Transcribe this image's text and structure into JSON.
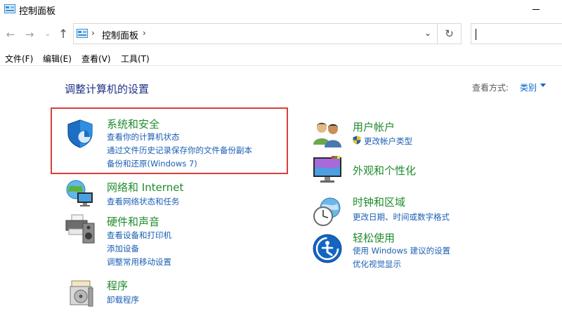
{
  "window": {
    "title": "控制面板"
  },
  "address": {
    "crumb": "控制面板",
    "separator": "›"
  },
  "search": {
    "placeholder": ""
  },
  "menu": {
    "file": "文件(F)",
    "edit": "编辑(E)",
    "view": "查看(V)",
    "tools": "工具(T)"
  },
  "main": {
    "heading": "调整计算机的设置",
    "view_by_label": "查看方式:",
    "view_by_value": "类别"
  },
  "categories": [
    {
      "title": "系统和安全",
      "icon": "shield-icon",
      "links": [
        "查看你的计算机状态",
        "通过文件历史记录保存你的文件备份副本",
        "备份和还原(Windows 7)"
      ]
    },
    {
      "title": "网络和 Internet",
      "icon": "network-globe-icon",
      "links": [
        "查看网络状态和任务"
      ]
    },
    {
      "title": "硬件和声音",
      "icon": "printer-icon",
      "links": [
        "查看设备和打印机",
        "添加设备",
        "调整常用移动设置"
      ]
    },
    {
      "title": "程序",
      "icon": "programs-icon",
      "links": [
        "卸载程序"
      ]
    },
    {
      "title": "用户帐户",
      "icon": "users-icon",
      "links": [
        "更改帐户类型"
      ]
    },
    {
      "title": "外观和个性化",
      "icon": "monitor-icon",
      "links": []
    },
    {
      "title": "时钟和区域",
      "icon": "clock-globe-icon",
      "links": [
        "更改日期、时间或数字格式"
      ]
    },
    {
      "title": "轻松使用",
      "icon": "ease-of-access-icon",
      "links": [
        "使用 Windows 建议的设置",
        "优化视觉显示"
      ]
    }
  ],
  "colors": {
    "category_title": "#1f8b2c",
    "link": "#1a5fb4",
    "heading": "#1e3287",
    "highlight": "#d9403a"
  }
}
